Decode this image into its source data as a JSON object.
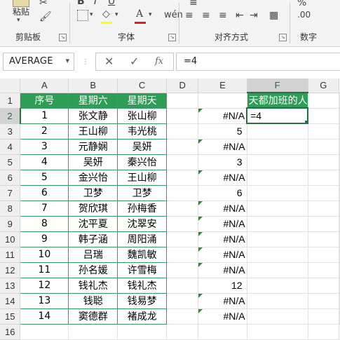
{
  "ribbon": {
    "paste_label": "粘贴",
    "groups": [
      {
        "label": "剪贴板"
      },
      {
        "label": "字体"
      },
      {
        "label": "对齐方式"
      },
      {
        "label": "数字"
      }
    ]
  },
  "formula_bar": {
    "name_box": "AVERAGE",
    "fx_label": "fx",
    "formula": "=4"
  },
  "columns": [
    "A",
    "B",
    "C",
    "D",
    "E",
    "F",
    "G"
  ],
  "rows": [
    "1",
    "2",
    "3",
    "4",
    "5",
    "6",
    "7",
    "8",
    "9",
    "10",
    "11",
    "12",
    "13",
    "14",
    "15",
    "16"
  ],
  "table": {
    "headers": [
      "序号",
      "星期六",
      "星期天"
    ],
    "rows": [
      [
        "1",
        "张文静",
        "张山柳"
      ],
      [
        "2",
        "王山柳",
        "韦光桃"
      ],
      [
        "3",
        "元静娴",
        "吴妍"
      ],
      [
        "4",
        "吴妍",
        "秦兴怡"
      ],
      [
        "5",
        "金兴怡",
        "王山柳"
      ],
      [
        "6",
        "卫梦",
        "卫梦"
      ],
      [
        "7",
        "贺欣琪",
        "孙梅香"
      ],
      [
        "8",
        "沈平夏",
        "沈翠安"
      ],
      [
        "9",
        "韩子涵",
        "周阳涌"
      ],
      [
        "10",
        "吕瑞",
        "魏凯敏"
      ],
      [
        "11",
        "孙名媛",
        "许雪梅"
      ],
      [
        "12",
        "钱礼杰",
        "钱礼杰"
      ],
      [
        "13",
        "钱聪",
        "钱易梦"
      ],
      [
        "14",
        "窦德群",
        "褚成龙"
      ]
    ]
  },
  "column_e": [
    "#N/A",
    "5",
    "#N/A",
    "3",
    "#N/A",
    "6",
    "#N/A",
    "#N/A",
    "#N/A",
    "#N/A",
    "#N/A",
    "12",
    "#N/A",
    "#N/A"
  ],
  "column_f": {
    "header": "天都加班的人",
    "active_cell": "=4"
  },
  "colors": {
    "table_header_bg": "#2e9e57",
    "selection": "#217346",
    "error_indicator": "#2e8b3e"
  }
}
